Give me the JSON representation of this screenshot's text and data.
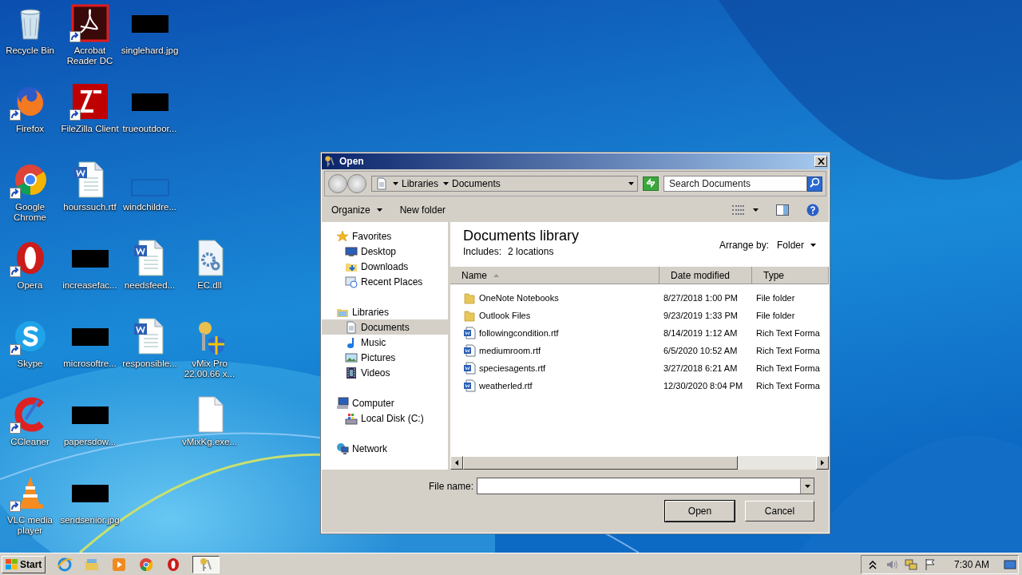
{
  "desktop_columns": [
    {
      "icons": [
        {
          "label": "Recycle Bin",
          "kind": "recycle",
          "shortcut": false
        },
        {
          "label": "Firefox",
          "kind": "firefox",
          "shortcut": true
        },
        {
          "label": "Google Chrome",
          "kind": "chrome",
          "shortcut": true
        },
        {
          "label": "Opera",
          "kind": "opera",
          "shortcut": true
        },
        {
          "label": "Skype",
          "kind": "skype",
          "shortcut": true
        },
        {
          "label": "CCleaner",
          "kind": "ccleaner",
          "shortcut": true
        },
        {
          "label": "VLC media player",
          "kind": "vlc",
          "shortcut": true
        }
      ]
    },
    {
      "icons": [
        {
          "label": "Acrobat Reader DC",
          "kind": "pdf",
          "shortcut": true
        },
        {
          "label": "FileZilla Client",
          "kind": "filezilla",
          "shortcut": true
        },
        {
          "label": "hourssuch.rtf",
          "kind": "word",
          "shortcut": false
        },
        {
          "label": "increasefac...",
          "kind": "redacted",
          "shortcut": false
        },
        {
          "label": "microsoftre...",
          "kind": "redacted",
          "shortcut": false
        },
        {
          "label": "papersdow...",
          "kind": "redacted",
          "shortcut": false
        },
        {
          "label": "sendsenior.jpg",
          "kind": "redacted",
          "shortcut": false
        }
      ]
    },
    {
      "icons": [
        {
          "label": "singlehard.jpg",
          "kind": "redacted",
          "shortcut": false
        },
        {
          "label": "trueoutdoor...",
          "kind": "redacted",
          "shortcut": false
        },
        {
          "label": "windchildre...",
          "kind": "outline",
          "shortcut": false
        },
        {
          "label": "needsfeed...",
          "kind": "word",
          "shortcut": false
        },
        {
          "label": "responsible...",
          "kind": "word",
          "shortcut": false
        }
      ]
    },
    {
      "icons": [
        {
          "label": "EC.dll",
          "kind": "dll",
          "shortcut": false
        },
        {
          "label": "vMix Pro 22.00.66 x...",
          "kind": "vmix",
          "shortcut": false
        },
        {
          "label": "vMixKg.exe...",
          "kind": "blank",
          "shortcut": false
        }
      ]
    }
  ],
  "dialog": {
    "title": "Open",
    "breadcrumb": [
      "Libraries",
      "Documents"
    ],
    "search_placeholder": "Search Documents",
    "toolbar": [
      "Organize",
      "New folder"
    ],
    "nav_groups": [
      {
        "label": "Favorites",
        "selected": false,
        "children": [
          {
            "label": "Desktop",
            "selected": false
          },
          {
            "label": "Downloads",
            "selected": false
          },
          {
            "label": "Recent Places",
            "selected": false
          }
        ]
      },
      {
        "label": "Libraries",
        "selected": false,
        "children": [
          {
            "label": "Documents",
            "selected": true
          },
          {
            "label": "Music",
            "selected": false
          },
          {
            "label": "Pictures",
            "selected": false
          },
          {
            "label": "Videos",
            "selected": false
          }
        ]
      },
      {
        "label": "Computer",
        "selected": false,
        "children": [
          {
            "label": "Local Disk (C:)",
            "selected": false
          }
        ]
      },
      {
        "label": "Network",
        "selected": false
      }
    ],
    "library_title": "Documents library",
    "includes_label": "Includes:",
    "includes_value": "2 locations",
    "arrange_label": "Arrange by:",
    "arrange_value": "Folder",
    "columns": [
      {
        "label": "Name",
        "sorted": true
      },
      {
        "label": "Date modified",
        "sorted": false
      },
      {
        "label": "Type",
        "sorted": false
      }
    ],
    "files": [
      {
        "name": "OneNote Notebooks",
        "date": "8/27/2018 1:00 PM",
        "type": "File folder",
        "kind": "folder"
      },
      {
        "name": "Outlook Files",
        "date": "9/23/2019 1:33 PM",
        "type": "File folder",
        "kind": "folder"
      },
      {
        "name": "followingcondition.rtf",
        "date": "8/14/2019 1:12 AM",
        "type": "Rich Text Forma",
        "kind": "rtf"
      },
      {
        "name": "mediumroom.rtf",
        "date": "6/5/2020 10:52 AM",
        "type": "Rich Text Forma",
        "kind": "rtf"
      },
      {
        "name": "speciesagents.rtf",
        "date": "3/27/2018 6:21 AM",
        "type": "Rich Text Forma",
        "kind": "rtf"
      },
      {
        "name": "weatherled.rtf",
        "date": "12/30/2020 8:04 PM",
        "type": "Rich Text Forma",
        "kind": "rtf"
      }
    ],
    "file_name_label": "File name:",
    "buttons": [
      {
        "label": "Open",
        "default": true
      },
      {
        "label": "Cancel",
        "default": false
      }
    ]
  },
  "taskbar": {
    "start": "Start",
    "apps": [
      {
        "kind": "ie",
        "active": false
      },
      {
        "kind": "explorer",
        "active": false
      },
      {
        "kind": "player",
        "active": false
      },
      {
        "kind": "chrome",
        "active": false
      },
      {
        "kind": "opera",
        "active": false
      },
      {
        "kind": "key",
        "active": true
      }
    ],
    "time": "7:30 AM"
  }
}
